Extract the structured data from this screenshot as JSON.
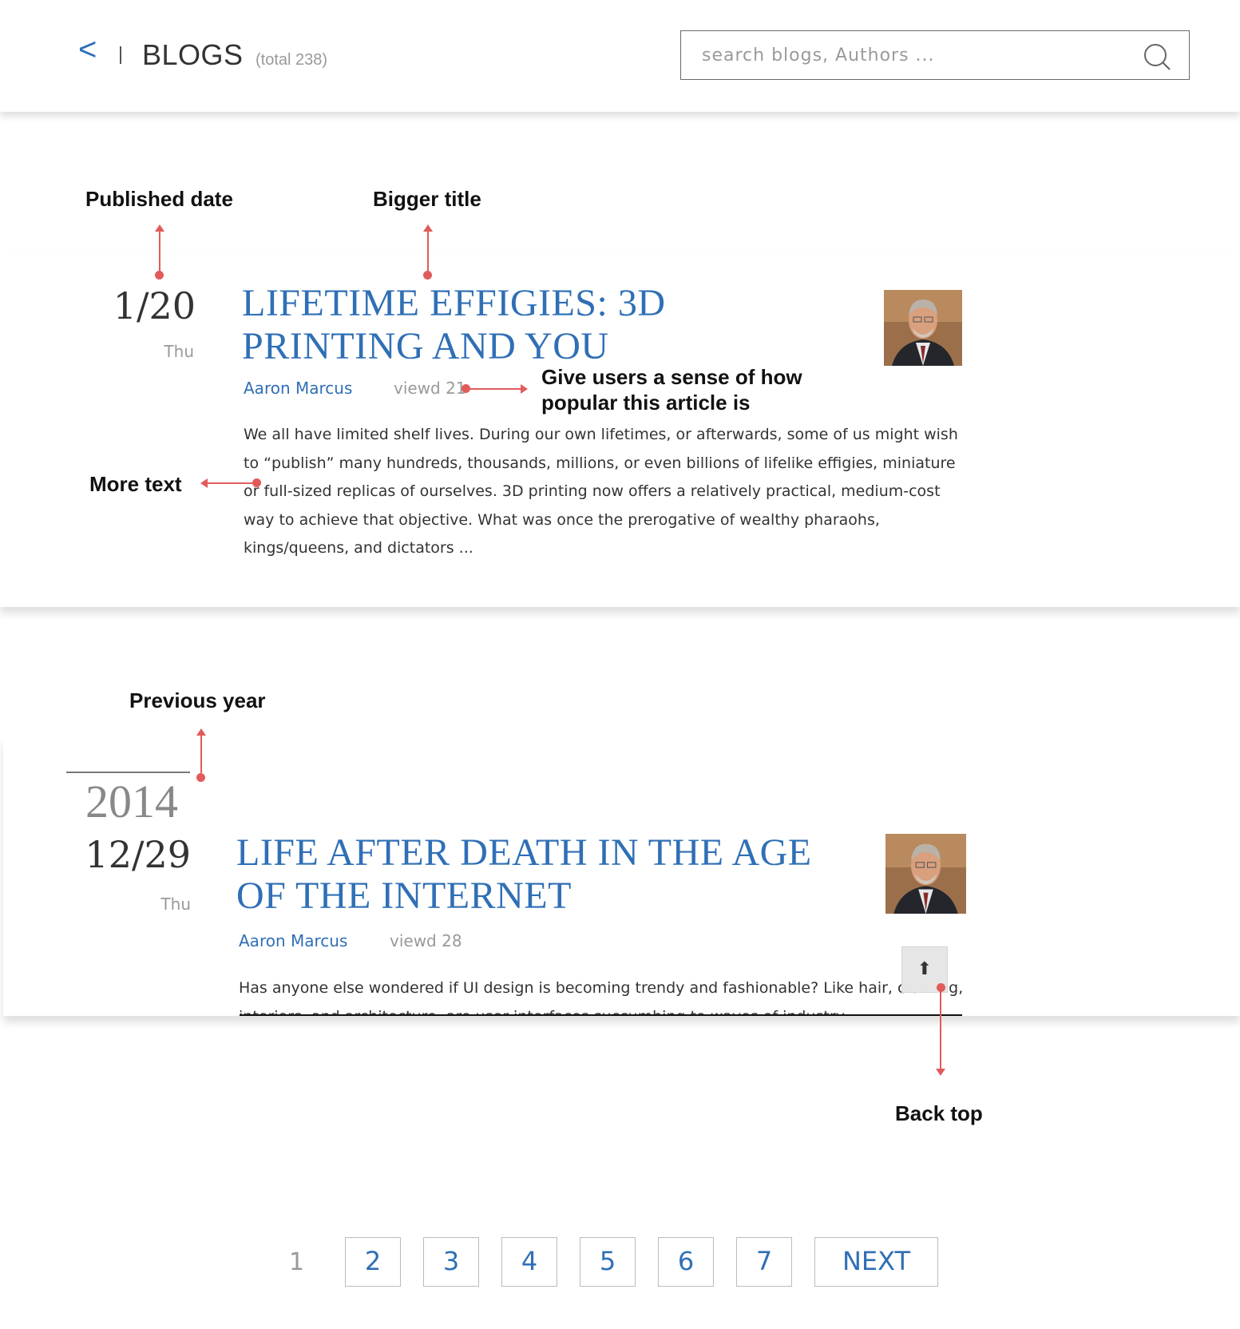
{
  "header": {
    "back_symbol": "<",
    "title": "BLOGS",
    "total": "(total 238)",
    "search_placeholder": "search blogs, Authors ..."
  },
  "annotations": {
    "published_date": "Published date",
    "bigger_title": "Bigger title",
    "popularity": "Give users a sense of how popular this article is",
    "more_text": "More text",
    "previous_year": "Previous year",
    "back_top": "Back top"
  },
  "posts": [
    {
      "date": "1/20",
      "day": "Thu",
      "title": "LIFETIME EFFIGIES: 3D PRINTING AND YOU",
      "author": "Aaron Marcus",
      "views": "viewd 21",
      "excerpt": "We all have limited shelf lives. During our own lifetimes, or afterwards, some of us might wish to “publish” many hundreds, thousands, millions, or even billions of lifelike effigies, miniature or full-sized replicas of ourselves. 3D printing now offers a relatively practical, medium-cost way to achieve that objective. What was once the prerogative of wealthy pharaohs, kings/queens, and dictators ..."
    },
    {
      "year": "2014",
      "date": "12/29",
      "day": "Thu",
      "title": "LIFE AFTER DEATH IN THE AGE OF THE INTERNET",
      "author": "Aaron Marcus",
      "views": "viewd 28",
      "excerpt": "Has anyone else wondered if UI design is becoming trendy and fashionable? Like hair, clothing, interiors, and architecture, are user interfaces succumbing to waves of industry"
    }
  ],
  "back_top_symbol": "⬆",
  "pagination": {
    "current": "1",
    "pages": [
      "2",
      "3",
      "4",
      "5",
      "6",
      "7"
    ],
    "next": "NEXT"
  }
}
